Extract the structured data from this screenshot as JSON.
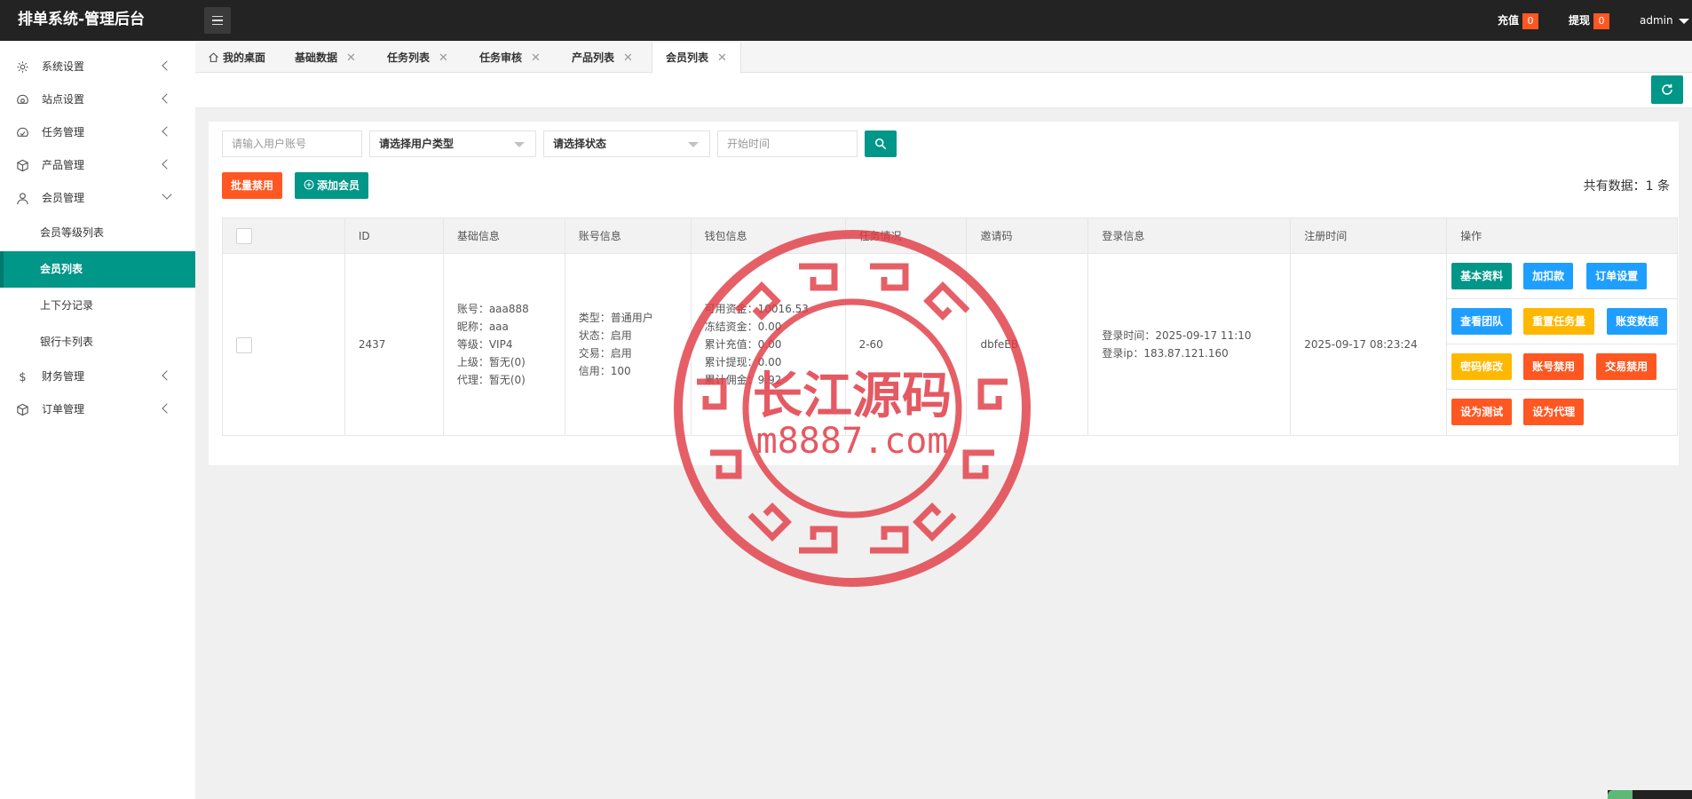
{
  "app": {
    "title": "排单系统-管理后台"
  },
  "header": {
    "recharge_label": "充值",
    "recharge_count": "0",
    "withdraw_label": "提现",
    "withdraw_count": "0",
    "user": "admin"
  },
  "sidebar": {
    "items": [
      {
        "label": "系统设置",
        "icon": "gear-icon"
      },
      {
        "label": "站点设置",
        "icon": "site-icon"
      },
      {
        "label": "任务管理",
        "icon": "task-icon"
      },
      {
        "label": "产品管理",
        "icon": "product-icon"
      },
      {
        "label": "会员管理",
        "icon": "user-icon"
      },
      {
        "label": "财务管理",
        "icon": "dollar-icon"
      },
      {
        "label": "订单管理",
        "icon": "order-icon"
      }
    ],
    "member_sub": [
      {
        "label": "会员等级列表"
      },
      {
        "label": "会员列表"
      },
      {
        "label": "上下分记录"
      },
      {
        "label": "银行卡列表"
      }
    ]
  },
  "tabs": [
    {
      "label": "我的桌面"
    },
    {
      "label": "基础数据"
    },
    {
      "label": "任务列表"
    },
    {
      "label": "任务审核"
    },
    {
      "label": "产品列表"
    },
    {
      "label": "会员列表"
    }
  ],
  "close_glyph": "✕",
  "filters": {
    "account_placeholder": "请输入用户账号",
    "user_type": "请选择用户类型",
    "status": "请选择状态",
    "start_time_placeholder": "开始时间"
  },
  "actions": {
    "batch_disable": "批量禁用",
    "add_member": "添加会员",
    "total": "共有数据：1 条"
  },
  "table": {
    "headers": [
      "ID",
      "基础信息",
      "账号信息",
      "钱包信息",
      "任务情况",
      "邀请码",
      "登录信息",
      "注册时间",
      "操作"
    ],
    "row": {
      "id": "2437",
      "basic": [
        "账号：aaa888",
        "昵称：aaa",
        "等级：VIP4",
        "上级：暂无(0)",
        "代理：暂无(0)"
      ],
      "account": [
        "类型：普通用户",
        "状态：启用",
        "交易：启用",
        "信用：100"
      ],
      "wallet": [
        "可用资金：10016.53",
        "冻结资金：0.00",
        "累计充值：0.00",
        "累计提现：0.00",
        "累计佣金：9.92"
      ],
      "task": "2-60",
      "invite": "dbfeEB",
      "login": [
        "登录时间：2025-09-17 11:10",
        "登录ip：183.87.121.160"
      ],
      "register": "2025-09-17 08:23:24"
    },
    "op_buttons": [
      [
        "基本资料",
        "加扣款",
        "订单设置"
      ],
      [
        "查看团队",
        "重置任务量",
        "账变数据"
      ],
      [
        "密码修改",
        "账号禁用",
        "交易禁用"
      ],
      [
        "设为测试",
        "设为代理"
      ]
    ]
  },
  "watermark": {
    "text_cn": "长江源码",
    "text_url": "m8887.com"
  },
  "colors": {
    "primary": "#009688",
    "danger": "#ff5722",
    "info": "#1e9fff",
    "warning": "#ffb800",
    "header_bg": "#232323",
    "watermark": "#e03c46"
  }
}
